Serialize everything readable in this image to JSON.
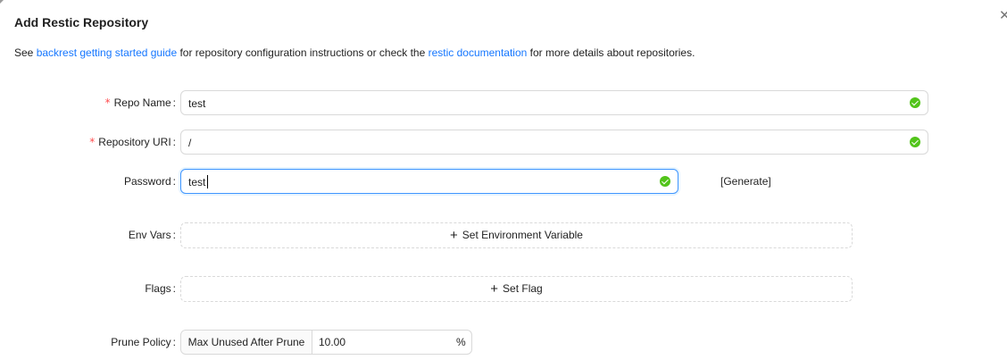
{
  "modal": {
    "title": "Add Restic Repository",
    "close_icon": "close-icon",
    "description": {
      "prefix": "See ",
      "link1": "backrest getting started guide",
      "middle": " for repository configuration instructions or check the ",
      "link2": "restic documentation",
      "suffix": " for more details about repositories."
    }
  },
  "form": {
    "required_mark": "*",
    "colon": ":",
    "repo_name": {
      "label": "Repo Name",
      "value": "test"
    },
    "repository_uri": {
      "label": "Repository URI",
      "value": "/"
    },
    "password": {
      "label": "Password",
      "value": "test",
      "generate": "[Generate]"
    },
    "env_vars": {
      "label": "Env Vars",
      "button": "Set Environment Variable"
    },
    "flags": {
      "label": "Flags",
      "button": "Set Flag"
    },
    "prune_policy": {
      "label": "Prune Policy",
      "addon": "Max Unused After Prune",
      "value": "10.00",
      "unit": "%"
    }
  },
  "colors": {
    "link": "#1677ff",
    "success": "#52c41a",
    "required": "#ff4d4f",
    "focus_border": "#4096ff"
  }
}
